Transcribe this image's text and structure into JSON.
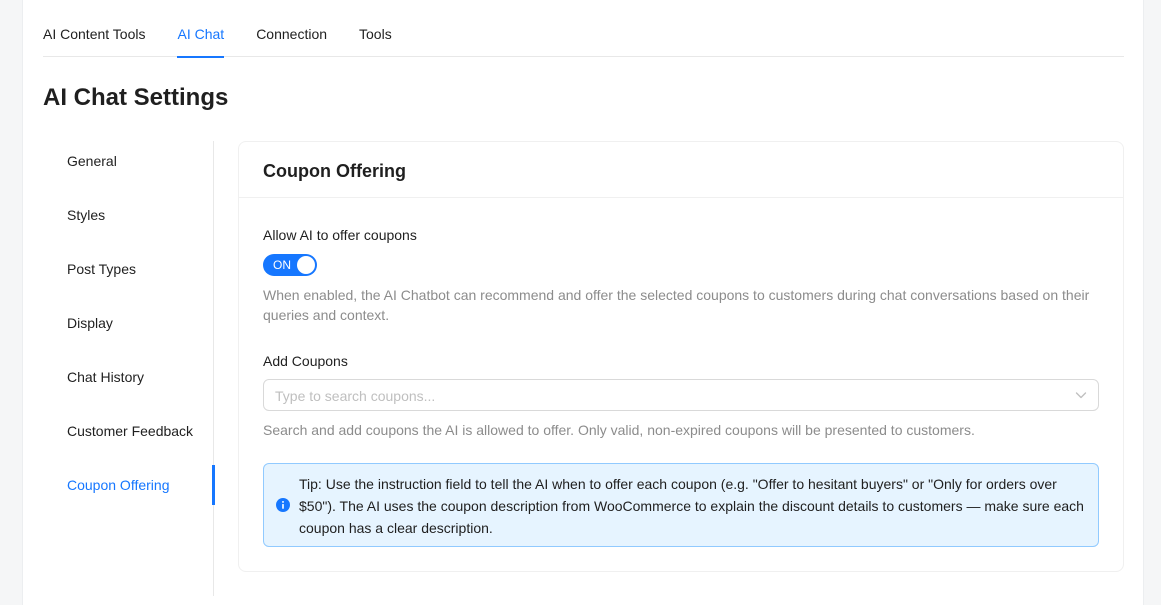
{
  "topnav": {
    "tabs": [
      "AI Content Tools",
      "AI Chat",
      "Connection",
      "Tools"
    ],
    "active": "AI Chat"
  },
  "page_title": "AI Chat Settings",
  "sidenav": {
    "items": [
      "General",
      "Styles",
      "Post Types",
      "Display",
      "Chat History",
      "Customer Feedback",
      "Coupon Offering"
    ],
    "active": "Coupon Offering"
  },
  "card": {
    "title": "Coupon Offering",
    "allow_label": "Allow AI to offer coupons",
    "toggle_text": "ON",
    "toggle_on": true,
    "allow_help": "When enabled, the AI Chatbot can recommend and offer the selected coupons to customers during chat conversations based on their queries and context.",
    "add_label": "Add Coupons",
    "search_placeholder": "Type to search coupons...",
    "add_help": "Search and add coupons the AI is allowed to offer. Only valid, non-expired coupons will be presented to customers.",
    "tip_text": "Tip: Use the instruction field to tell the AI when to offer each coupon (e.g. \"Offer to hesitant buyers\" or \"Only for orders over $50\"). The AI uses the coupon description from WooCommerce to explain the discount details to customers — make sure each coupon has a clear description."
  },
  "colors": {
    "accent": "#1677ff",
    "tip_background": "#e6f4ff",
    "tip_border": "#91caff",
    "muted_text": "#8c8c8c"
  },
  "icons": {
    "select_arrow": "chevron-down-icon",
    "tip_icon": "info-icon"
  }
}
